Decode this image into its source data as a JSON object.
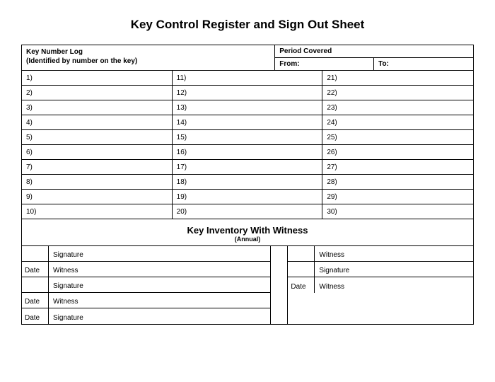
{
  "title": "Key Control Register and Sign Out Sheet",
  "header": {
    "keyLogTitle": "Key Number Log",
    "keyLogSub": "(Identified by number on the key)",
    "periodTitle": "Period Covered",
    "fromLabel": "From:",
    "toLabel": "To:"
  },
  "log": {
    "col1": [
      "1)",
      "2)",
      "3)",
      "4)",
      "5)",
      "6)",
      "7)",
      "8)",
      "9)",
      "10)"
    ],
    "col2": [
      "11)",
      "12)",
      "13)",
      "14)",
      "15)",
      "16)",
      "17)",
      "18)",
      "19)",
      "20)"
    ],
    "col3": [
      "21)",
      "22)",
      "23)",
      "24)",
      "25)",
      "26)",
      "27)",
      "28)",
      "29)",
      "30)"
    ]
  },
  "inventory": {
    "title": "Key Inventory With Witness",
    "sub": "(Annual)"
  },
  "witness": {
    "left": [
      {
        "date": "",
        "label": "Signature"
      },
      {
        "date": "Date",
        "label": "Witness"
      },
      {
        "date": "",
        "label": "Signature"
      },
      {
        "date": "Date",
        "label": "Witness"
      },
      {
        "date": "Date",
        "label": "Signature"
      }
    ],
    "right": [
      {
        "date": "",
        "label": "Witness"
      },
      {
        "date": "",
        "label": "Signature"
      },
      {
        "date": "Date",
        "label": "Witness"
      }
    ]
  }
}
